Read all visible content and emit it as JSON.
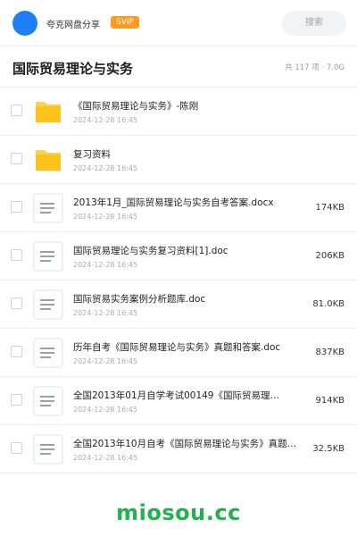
{
  "header": {
    "username": "夸克网盘分享",
    "vip_badge": "SVIP",
    "search_placeholder": "搜索"
  },
  "folder": {
    "title": "国际贸易理论与实务",
    "summary": "共 117 项 · 7.0G"
  },
  "files": [
    {
      "type": "folder",
      "name": "《国际贸易理论与实务》-陈刚",
      "date": "2024-12-28 16:45",
      "size": ""
    },
    {
      "type": "folder",
      "name": "复习资料",
      "date": "2024-12-28 16:45",
      "size": ""
    },
    {
      "type": "doc",
      "name": "2013年1月_国际贸易理论与实务自考答案.docx",
      "date": "2024-12-28 16:45",
      "size": "174KB"
    },
    {
      "type": "doc",
      "name": "国际贸易理论与实务复习资料[1].doc",
      "date": "2024-12-28 16:45",
      "size": "206KB"
    },
    {
      "type": "doc",
      "name": "国际贸易实务案例分析题库.doc",
      "date": "2024-12-28 16:45",
      "size": "81.0KB"
    },
    {
      "type": "doc",
      "name": "历年自考《国际贸易理论与实务》真题和答案.doc",
      "date": "2024-12-28 16:45",
      "size": "837KB"
    },
    {
      "type": "doc",
      "name": "全国2013年01月自学考试00149《国际贸易理…",
      "date": "2024-12-28 16:45",
      "size": "914KB"
    },
    {
      "type": "doc",
      "name": "全国2013年10月自考《国际贸易理论与实务》真题…",
      "date": "2024-12-28 16:45",
      "size": "32.5KB"
    }
  ],
  "watermark": "miosou.cc",
  "colors": {
    "accent": "#1e7ff5",
    "vip": "#ff9a1f",
    "folder": "#ffc21a",
    "watermark": "#22b14c"
  }
}
